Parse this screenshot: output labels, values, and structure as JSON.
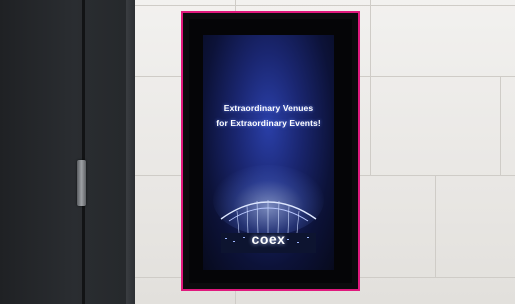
{
  "sign": {
    "headline_line1": "Extraordinary Venues",
    "headline_line2": "for Extraordinary Events!",
    "logo_text": "coex"
  },
  "colors": {
    "kiosk_outline": "#e0197d",
    "screen_blue": "#1a2670",
    "door": "#26292d",
    "wall": "#ebe9e6"
  }
}
